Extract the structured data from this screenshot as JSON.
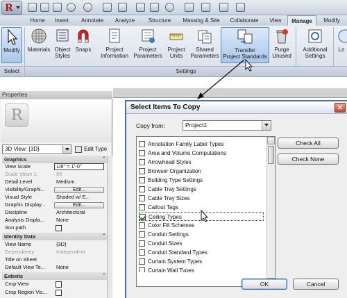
{
  "tabs": [
    "Home",
    "Insert",
    "Annotate",
    "Analyze",
    "Structure",
    "Massing & Site",
    "Collaborate",
    "View",
    "Manage",
    "Modify"
  ],
  "active_tab": "Manage",
  "ribbon": {
    "select_panel": {
      "modify": "Modify",
      "label": "Select"
    },
    "settings_panel": {
      "materials": "Materials",
      "object_styles": [
        "Object",
        "Styles"
      ],
      "snaps": "Snaps",
      "project_information": [
        "Project",
        "Information"
      ],
      "project_parameters": [
        "Project",
        "Parameters"
      ],
      "project_units": [
        "Project",
        "Units"
      ],
      "shared_parameters": [
        "Shared",
        "Parameters"
      ],
      "transfer_project_standards": [
        "Transfer",
        "Project Standards"
      ],
      "purge_unused": [
        "Purge",
        "Unused"
      ],
      "additional_settings": [
        "Additional",
        "Settings"
      ],
      "label": "Settings"
    },
    "cut_off": "Lo"
  },
  "properties": {
    "title": "Properties",
    "type_selector": "3D View: {3D}",
    "edit_type": "Edit Type",
    "groups": {
      "graphics": "Graphics",
      "identity": "Identity Data",
      "extents": "Extents"
    },
    "rows": {
      "view_scale": {
        "k": "View Scale",
        "v": "1/8\" = 1'-0\""
      },
      "scale_value": {
        "k": "Scale Value    1:",
        "v": "96"
      },
      "detail_level": {
        "k": "Detail Level",
        "v": "Medium"
      },
      "visibility": {
        "k": "Visibility/Graphi...",
        "v": "Edit..."
      },
      "visual_style": {
        "k": "Visual Style",
        "v": "Shaded w/ E..."
      },
      "graphic_display": {
        "k": "Graphic Display...",
        "v": "Edit..."
      },
      "discipline": {
        "k": "Discipline",
        "v": "Architectural"
      },
      "analysis_display": {
        "k": "Analysis Displa...",
        "v": "None"
      },
      "sun_path": {
        "k": "Sun path",
        "v": ""
      },
      "view_name": {
        "k": "View Name",
        "v": "{3D}"
      },
      "dependency": {
        "k": "Dependency",
        "v": "Independent"
      },
      "title_on_sheet": {
        "k": "Title on Sheet",
        "v": ""
      },
      "default_view_template": {
        "k": "Default View Te...",
        "v": "None"
      },
      "crop_view": {
        "k": "Crop View",
        "v": ""
      },
      "crop_region_visible": {
        "k": "Crop Region Vis...",
        "v": ""
      }
    }
  },
  "dialog": {
    "title": "Select Items To Copy",
    "copy_from_label": "Copy from:",
    "copy_from_value": "Project1",
    "items": [
      {
        "label": "Annotation Family Label Types",
        "checked": false
      },
      {
        "label": "Area and Volume Computations",
        "checked": false
      },
      {
        "label": "Arrowhead Styles",
        "checked": false
      },
      {
        "label": "Browser Organization",
        "checked": false
      },
      {
        "label": "Building Type Settings",
        "checked": false
      },
      {
        "label": "Cable Tray Settings",
        "checked": false
      },
      {
        "label": "Cable Tray Sizes",
        "checked": false
      },
      {
        "label": "Callout Tags",
        "checked": false
      },
      {
        "label": "Ceiling Types",
        "checked": true
      },
      {
        "label": "Color Fill Schemes",
        "checked": false
      },
      {
        "label": "Conduit Settings",
        "checked": false
      },
      {
        "label": "Conduit Sizes",
        "checked": false
      },
      {
        "label": "Conduit Standard Types",
        "checked": false
      },
      {
        "label": "Curtain System Types",
        "checked": false
      },
      {
        "label": "Curtain Wall Types",
        "checked": false
      }
    ],
    "check_all": "Check All",
    "check_none": "Check None",
    "ok": "OK",
    "cancel": "Cancel"
  },
  "colors": {
    "accent": "#4c6d99",
    "app_red": "#b01717",
    "check_green": "#1c7a1c"
  },
  "icons": [
    "app-menu-icon",
    "open-icon",
    "save-icon",
    "sync-icon",
    "undo-icon",
    "redo-icon",
    "print-icon",
    "measure-icon",
    "materials-icon",
    "snaps-icon",
    "transfer-standards-icon",
    "purge-icon",
    "close-icon",
    "mouse-pointer-icon"
  ]
}
